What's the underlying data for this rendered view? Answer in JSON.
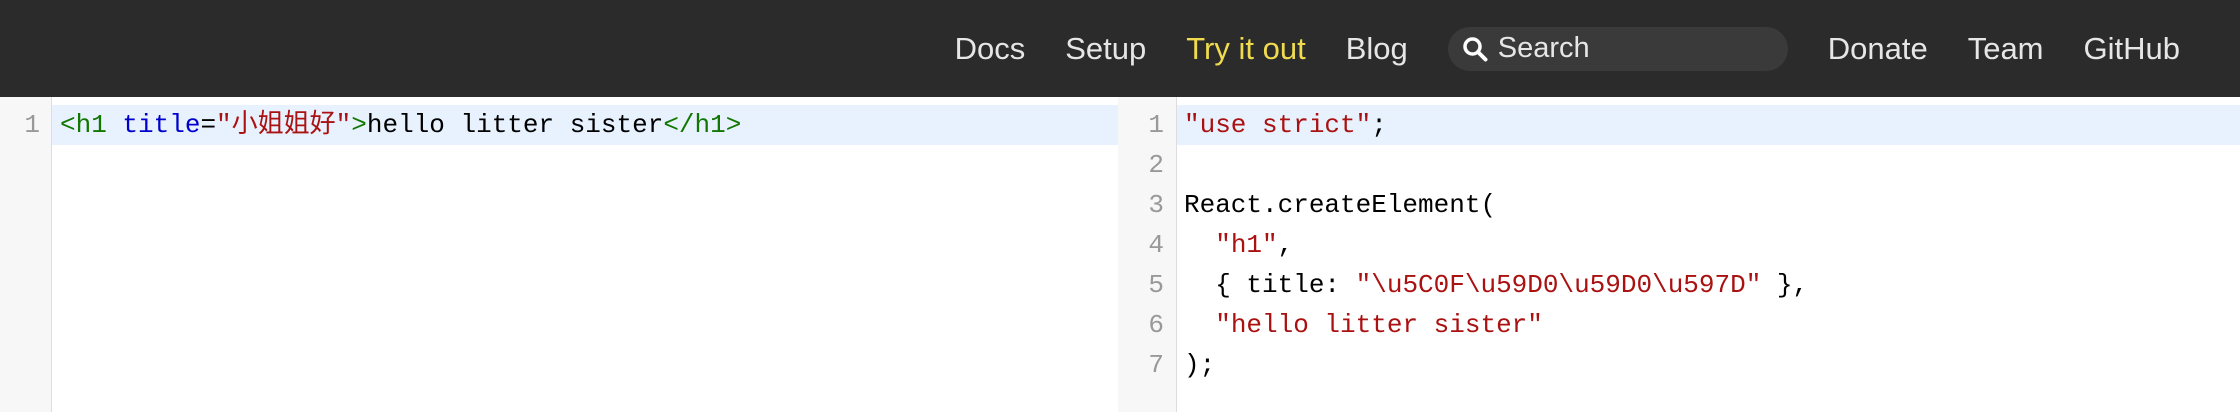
{
  "nav": {
    "items": [
      {
        "label": "Docs"
      },
      {
        "label": "Setup"
      },
      {
        "label": "Try it out"
      },
      {
        "label": "Blog"
      }
    ],
    "search_placeholder": "Search",
    "items_after": [
      {
        "label": "Donate"
      },
      {
        "label": "Team"
      },
      {
        "label": "GitHub"
      }
    ],
    "active": "Try it out",
    "active_color": "#f0db4f"
  },
  "input_editor": {
    "lines": [
      {
        "number": "1",
        "tokens": [
          {
            "type": "tag",
            "text": "<h1"
          },
          {
            "type": "plain",
            "text": " "
          },
          {
            "type": "attr",
            "text": "title"
          },
          {
            "type": "plain",
            "text": "="
          },
          {
            "type": "str",
            "text": "\"小姐姐好\""
          },
          {
            "type": "tag",
            "text": ">"
          },
          {
            "type": "plain",
            "text": "hello litter sister"
          },
          {
            "type": "tag",
            "text": "</h1>"
          }
        ]
      }
    ]
  },
  "output_editor": {
    "lines": [
      {
        "number": "1",
        "tokens": [
          {
            "type": "str",
            "text": "\"use strict\""
          },
          {
            "type": "plain",
            "text": ";"
          }
        ]
      },
      {
        "number": "2",
        "tokens": []
      },
      {
        "number": "3",
        "tokens": [
          {
            "type": "plain",
            "text": "React.createElement("
          }
        ]
      },
      {
        "number": "4",
        "tokens": [
          {
            "type": "plain",
            "text": "  "
          },
          {
            "type": "str",
            "text": "\"h1\""
          },
          {
            "type": "plain",
            "text": ","
          }
        ]
      },
      {
        "number": "5",
        "tokens": [
          {
            "type": "plain",
            "text": "  { title: "
          },
          {
            "type": "str",
            "text": "\"\\u5C0F\\u59D0\\u59D0\\u597D\""
          },
          {
            "type": "plain",
            "text": " },"
          }
        ]
      },
      {
        "number": "6",
        "tokens": [
          {
            "type": "plain",
            "text": "  "
          },
          {
            "type": "str",
            "text": "\"hello litter sister\""
          }
        ]
      },
      {
        "number": "7",
        "tokens": [
          {
            "type": "plain",
            "text": ");"
          }
        ]
      }
    ]
  }
}
